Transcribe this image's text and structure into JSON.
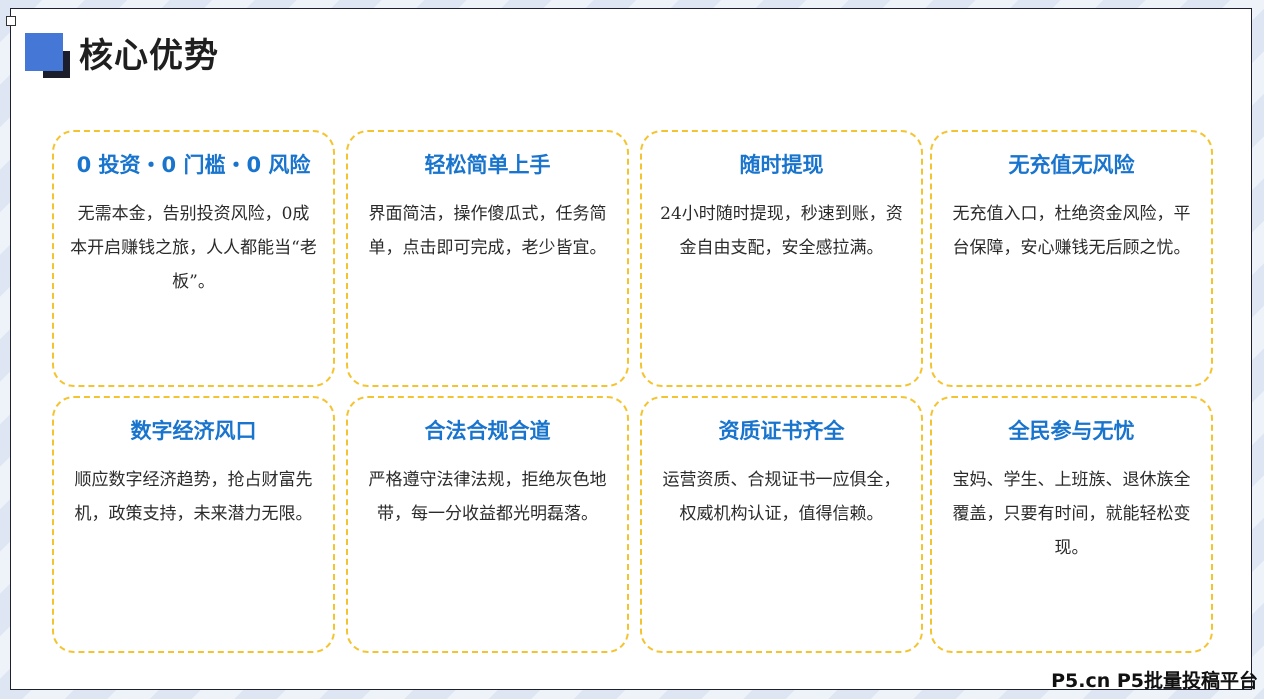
{
  "page": {
    "title": "核心优势"
  },
  "cards": [
    {
      "title": "0 投资・0 门槛・0 风险",
      "desc": "无需本金，告别投资风险，0成本开启赚钱之旅，人人都能当“老板”。"
    },
    {
      "title": "轻松简单上手",
      "desc": "界面简洁，操作傻瓜式，任务简单，点击即可完成，老少皆宜。"
    },
    {
      "title": "随时提现",
      "desc": "24小时随时提现，秒速到账，资金自由支配，安全感拉满。"
    },
    {
      "title": "无充值无风险",
      "desc": "无充值入口，杜绝资金风险，平台保障，安心赚钱无后顾之忧。"
    },
    {
      "title": "数字经济风口",
      "desc": "顺应数字经济趋势，抢占财富先机，政策支持，未来潜力无限。"
    },
    {
      "title": "合法合规合道",
      "desc": "严格遵守法律法规，拒绝灰色地带，每一分收益都光明磊落。"
    },
    {
      "title": "资质证书齐全",
      "desc": "运营资质、合规证书一应俱全，权威机构认证，值得信赖。"
    },
    {
      "title": "全民参与无忧",
      "desc": "宝妈、学生、上班族、退休族全覆盖，只要有时间，就能轻松变现。"
    }
  ],
  "footer": {
    "watermark": "P5.cn P5批量投稿平台"
  },
  "colors": {
    "accent_blue": "#4577d6",
    "card_title": "#1874cd",
    "card_border": "#f4c430",
    "dark_block": "#1c1f2b"
  }
}
